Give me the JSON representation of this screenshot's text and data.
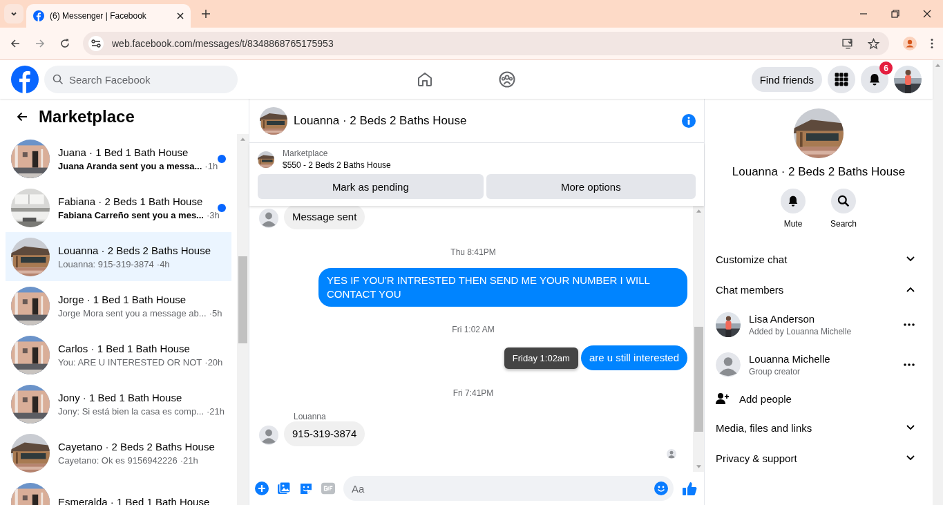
{
  "browser": {
    "tab_title": "(6) Messenger | Facebook",
    "url": "web.facebook.com/messages/t/8348868765175953"
  },
  "header": {
    "search_placeholder": "Search Facebook",
    "find_friends": "Find friends",
    "notification_count": "6"
  },
  "sidebar": {
    "title": "Marketplace",
    "conversations": [
      {
        "title": "Juana · 1 Bed 1 Bath House",
        "preview": "Juana Aranda sent you a messa...",
        "time": "·1h",
        "unread": true,
        "selected": false
      },
      {
        "title": "Fabiana · 2 Beds 1 Bath House",
        "preview": "Fabiana Carreño sent you a mes...",
        "time": "·3h",
        "unread": true,
        "selected": false
      },
      {
        "title": "Louanna · 2 Beds 2 Baths House",
        "preview": "Louanna: 915-319-3874",
        "time": "·4h",
        "unread": false,
        "selected": true
      },
      {
        "title": "Jorge · 1 Bed 1 Bath House",
        "preview": "Jorge Mora sent you a message ab...",
        "time": "·5h",
        "unread": false,
        "selected": false
      },
      {
        "title": "Carlos · 1 Bed 1 Bath House",
        "preview": "You: ARE U INTERESTED OR NOT",
        "time": "·20h",
        "unread": false,
        "selected": false
      },
      {
        "title": "Jony · 1 Bed 1 Bath House",
        "preview": "Jony: Si está bien la casa es comp...",
        "time": "·21h",
        "unread": false,
        "selected": false
      },
      {
        "title": "Cayetano · 2 Beds 2 Baths House",
        "preview": "Cayetano: Ok es 9156942226",
        "time": "·21h",
        "unread": false,
        "selected": false
      },
      {
        "title": "Esmeralda · 1 Bed 1 Bath House",
        "unread": false,
        "selected": false
      }
    ]
  },
  "chat": {
    "title": "Louanna · 2 Beds 2 Baths House",
    "listing": {
      "label": "Marketplace",
      "item": "$550 - 2 Beds 2 Baths House"
    },
    "actions": [
      "Mark as pending",
      "More options"
    ],
    "messages": [
      {
        "kind": "incoming",
        "text": "Message sent"
      },
      {
        "kind": "timestamp",
        "text": "Thu 8:41PM"
      },
      {
        "kind": "outgoing",
        "text": "YES IF YOU'R INTRESTED THEN SEND ME YOUR NUMBER I WILL CONTACT YOU"
      },
      {
        "kind": "timestamp",
        "text": "Fri 1:02 AM"
      },
      {
        "kind": "outgoing",
        "text": "are u still interested",
        "tooltip": "Friday 1:02am"
      },
      {
        "kind": "timestamp",
        "text": "Fri 7:41PM"
      },
      {
        "kind": "incoming",
        "sender": "Louanna",
        "text": "915-319-3874"
      }
    ],
    "composer_placeholder": "Aa"
  },
  "details": {
    "title": "Louanna · 2 Beds 2 Baths House",
    "actions": [
      "Mute",
      "Search"
    ],
    "sections": [
      {
        "label": "Customize chat",
        "expanded": false
      },
      {
        "label": "Chat members",
        "expanded": true,
        "members": [
          {
            "name": "Lisa Anderson",
            "role": "Added by Louanna Michelle"
          },
          {
            "name": "Louanna Michelle",
            "role": "Group creator",
            "kind": "default"
          }
        ],
        "add_label": "Add people"
      },
      {
        "label": "Media, files and links",
        "expanded": false
      },
      {
        "label": "Privacy & support",
        "expanded": false
      }
    ]
  }
}
